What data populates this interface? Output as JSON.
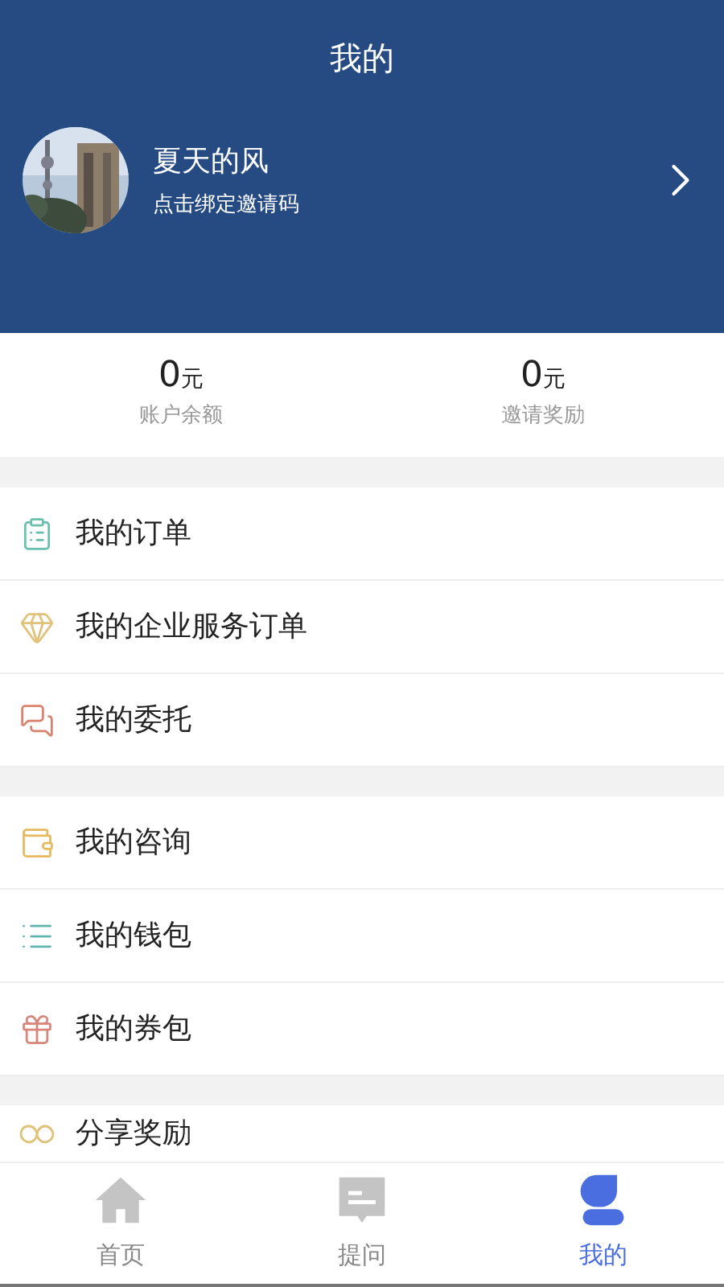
{
  "header": {
    "title": "我的"
  },
  "profile": {
    "name": "夏天的风",
    "subtitle": "点击绑定邀请码"
  },
  "stats": [
    {
      "value": "0",
      "unit": "元",
      "label": "账户余额"
    },
    {
      "value": "0",
      "unit": "元",
      "label": "邀请奖励"
    }
  ],
  "menu_groups": [
    [
      {
        "kind": "clipboard",
        "label": "我的订单",
        "color": "#6bbfae"
      },
      {
        "kind": "diamond",
        "label": "我的企业服务订单",
        "color": "#e0c27a"
      },
      {
        "kind": "chat",
        "label": "我的委托",
        "color": "#d9826e"
      }
    ],
    [
      {
        "kind": "wallet",
        "label": "我的咨询",
        "color": "#e6b95f"
      },
      {
        "kind": "list",
        "label": "我的钱包",
        "color": "#5fb5b0"
      },
      {
        "kind": "gift",
        "label": "我的券包",
        "color": "#d9857a"
      }
    ],
    [
      {
        "kind": "share",
        "label": "分享奖励",
        "color": "#e0c27a"
      }
    ]
  ],
  "tab_bar": [
    {
      "kind": "home",
      "label": "首页",
      "selected": false
    },
    {
      "kind": "question",
      "label": "提问",
      "selected": false
    },
    {
      "kind": "profile",
      "label": "我的",
      "selected": true
    }
  ]
}
